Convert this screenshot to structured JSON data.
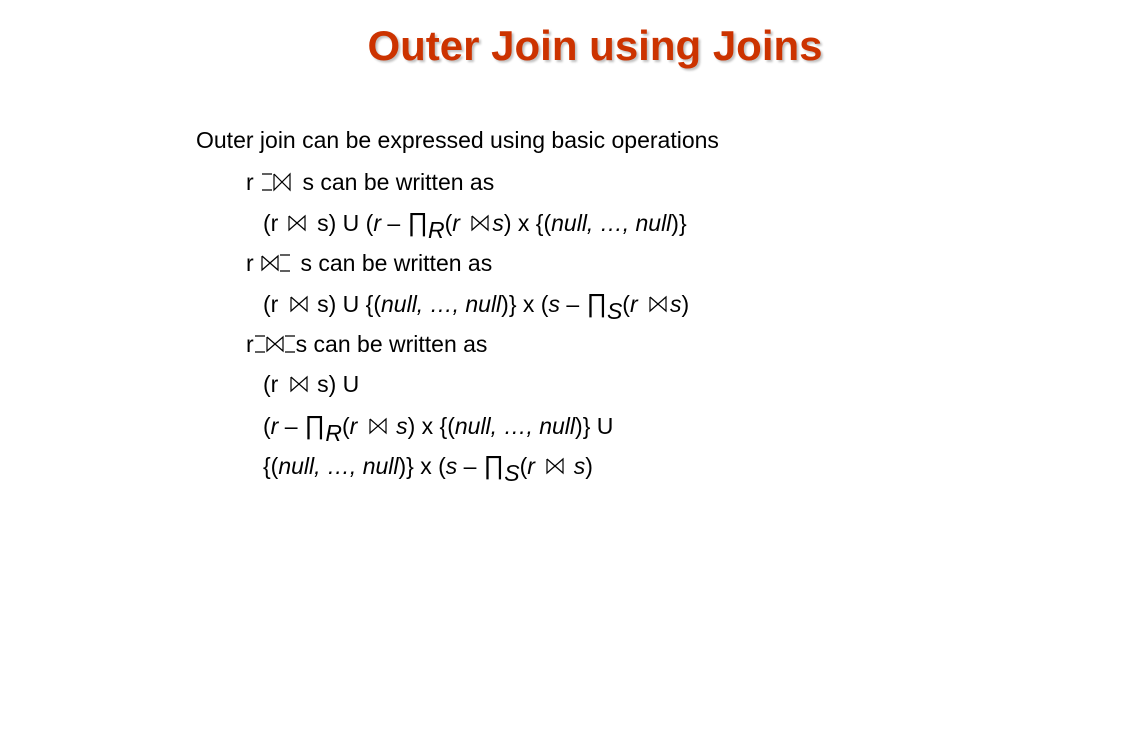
{
  "slide": {
    "title": "Outer Join using Joins",
    "intro": "Outer join can be expressed using basic operations",
    "left_outer": {
      "head_left": "r",
      "head_right": "s can be written as",
      "expr": {
        "p1": "(r",
        "p2": "s)  U (",
        "r": "r",
        "minus": " – ",
        "prod": "∏",
        "sub": "R",
        "p3": "(",
        "r2": "r",
        "s2": "s",
        "p4": ")  x {(",
        "nulls": "null, …, null",
        "p5": ")}"
      }
    },
    "right_outer": {
      "head_left": "r",
      "head_right": "s can be written as",
      "expr": {
        "p1": "(r",
        "p2": "s)  U {(",
        "nulls": "null, …, null",
        "p3": ")} x (",
        "s": "s",
        "minus": " – ",
        "prod": "∏",
        "sub": "S",
        "p4": "(",
        "r2": "r",
        "s2": "s",
        "p5": ")"
      }
    },
    "full_outer": {
      "head_left": "r",
      "head_right": "s can be written as",
      "line1": {
        "p1": "(r",
        "p2": "s)  U"
      },
      "line2": {
        "p1": "(",
        "r": "r",
        "minus": " – ",
        "prod": "∏",
        "sub": "R",
        "p2": "(",
        "r2": "r",
        "s2": "s",
        "p3": ")  x {(",
        "nulls": "null, …, null",
        "p4": ")} U"
      },
      "line3": {
        "p1": "{(",
        "nulls": "null, …, null",
        "p2": ")} x (",
        "s": "s",
        "minus": " – ",
        "prod": "∏",
        "sub": "S",
        "p3": "(",
        "r2": "r",
        "s2": "s",
        "p4": ")"
      }
    }
  }
}
